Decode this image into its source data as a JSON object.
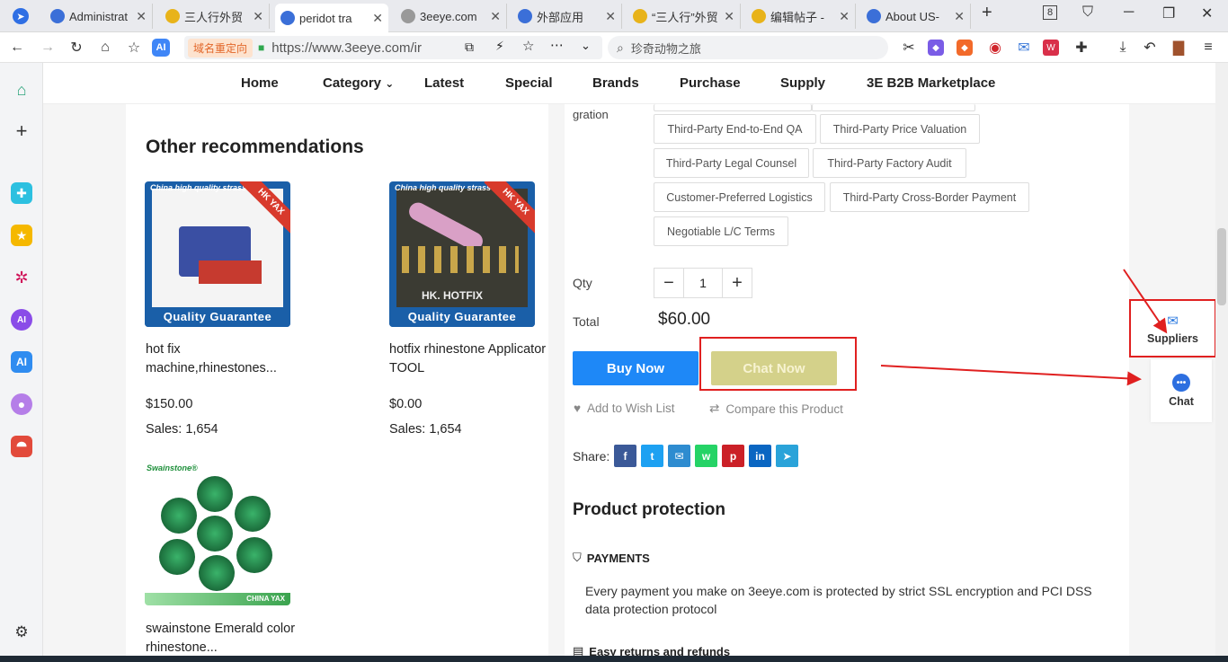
{
  "browser": {
    "tabs": [
      {
        "title": "Administrat",
        "color": "#3b6fd8",
        "glyph": "●"
      },
      {
        "title": "三人行外贸",
        "color": "#e8b31a",
        "glyph": "●"
      },
      {
        "title": "peridot tra",
        "color": "#3b6fd8",
        "glyph": "●"
      },
      {
        "title": "3eeye.com",
        "color": "#999999",
        "glyph": "●"
      },
      {
        "title": "外部应用",
        "color": "#3b6fd8",
        "glyph": "●"
      },
      {
        "title": "“三人行”外贸",
        "color": "#e8b31a",
        "glyph": "●"
      },
      {
        "title": "编辑帖子 -",
        "color": "#e8b31a",
        "glyph": "●"
      },
      {
        "title": "About US-",
        "color": "#3b6fd8",
        "glyph": "●"
      }
    ],
    "tab_count": "8",
    "url_tag": "域名重定向",
    "url": "https://www.3eeye.com/ir",
    "search_text": "珍奇动物之旅"
  },
  "nav": {
    "home": "Home",
    "category": "Category",
    "latest": "Latest",
    "special": "Special",
    "brands": "Brands",
    "purchase": "Purchase",
    "supply": "Supply",
    "b2b": "3E B2B Marketplace"
  },
  "recommendations": {
    "title": "Other recommendations",
    "items": [
      {
        "name": "hot fix machine,rhinestones...",
        "price": "$150.00",
        "sales": "Sales: 1,654",
        "img_banner": "China high quality strass",
        "img_corner": "HK YAX",
        "img_footer": "Quality Guarantee"
      },
      {
        "name": "hotfix rhinestone Applicator TOOL",
        "price": "$0.00",
        "sales": "Sales: 1,654",
        "img_banner": "China high quality strass",
        "img_corner": "HK YAX",
        "img_footer": "Quality Guarantee",
        "img_brand": "HK. HOTFIX"
      },
      {
        "name": "swainstone Emerald color rhinestone...",
        "img_brand": "Swainstone®",
        "img_footer": "CHINA YAX"
      }
    ]
  },
  "product": {
    "gration_label": "gration",
    "services": [
      "Third-Party End-to-End QA",
      "Third-Party Price Valuation",
      "Third-Party Legal Counsel",
      "Third-Party Factory Audit",
      "Customer-Preferred Logistics",
      "Third-Party Cross-Border Payment",
      "Negotiable L/C Terms"
    ],
    "qty_label": "Qty",
    "qty_value": "1",
    "qty_minus": "−",
    "qty_plus": "+",
    "total_label": "Total",
    "total_value": "$60.00",
    "buy_label": "Buy Now",
    "chat_label": "Chat Now",
    "wish_label": "Add to Wish List",
    "compare_label": "Compare this Product",
    "share_label": "Share:",
    "share_icons": [
      "f",
      "t",
      "✉",
      "w",
      "p",
      "in",
      "➤"
    ],
    "share_colors": [
      "#3b5998",
      "#1da1f2",
      "#2e8cd0",
      "#25d366",
      "#cb2027",
      "#0a66c2",
      "#2aa3d9"
    ]
  },
  "protection": {
    "title": "Product protection",
    "payments_title": "PAYMENTS",
    "payments_text": "Every payment you make on 3eeye.com is protected by strict SSL encryption and PCI DSS data protection protocol",
    "returns_title": "Easy returns and refunds"
  },
  "floating": {
    "suppliers_label": "Suppliers",
    "chat_label": "Chat"
  },
  "colors": {
    "accent_blue": "#1e88f7",
    "chat_btn": "#d4d18a",
    "annotation_red": "#e02020"
  }
}
